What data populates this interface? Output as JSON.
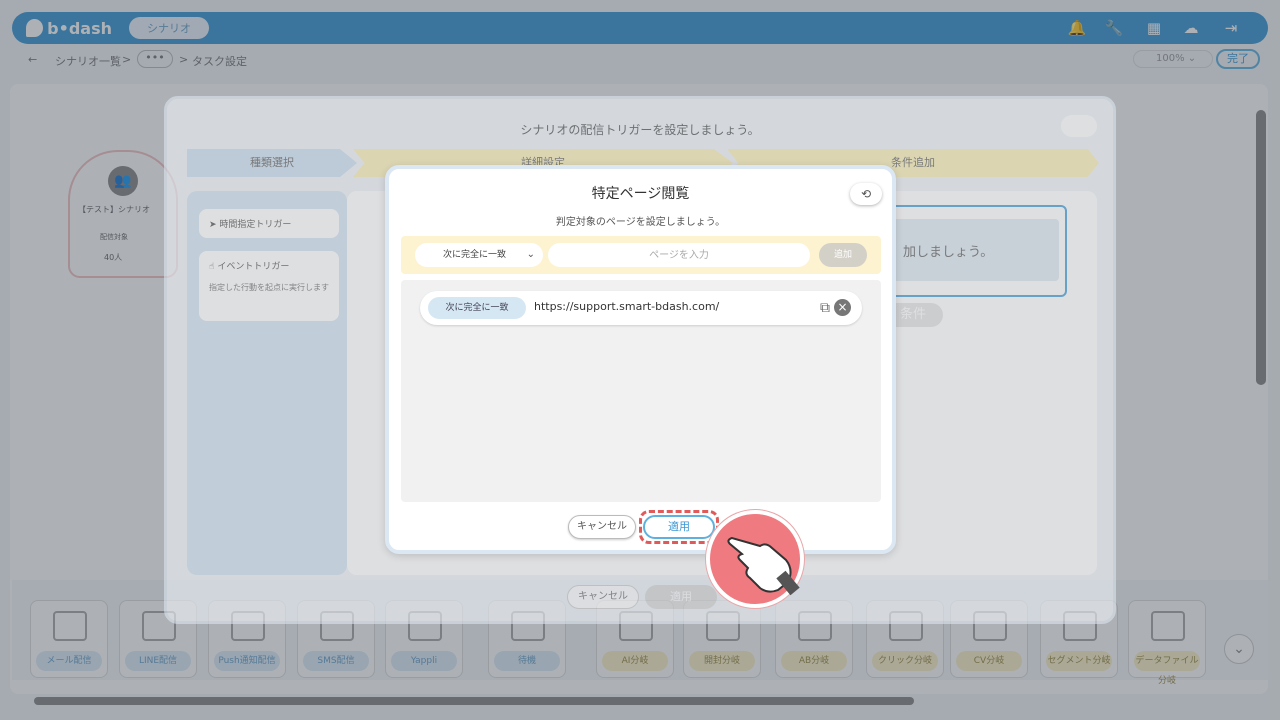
{
  "app": {
    "logo_text": "b•dash",
    "scenario_button": "シナリオ"
  },
  "header_icons": [
    "bell-icon",
    "wrench-icon",
    "grid-icon",
    "chat-icon",
    "logout-icon"
  ],
  "breadcrumb": {
    "back": "←",
    "list": "シナリオ一覧",
    "sep1": ">",
    "more": "•••",
    "sep2": ">",
    "current": "タスク設定"
  },
  "toolbar": {
    "zoom": "100%",
    "done": "完了"
  },
  "node": {
    "title": "【テスト】シナリオ",
    "sub": "配信対象",
    "count": "40人"
  },
  "palette": {
    "items": [
      {
        "label": "メール配信",
        "style": "blue"
      },
      {
        "label": "LINE配信",
        "style": "blue"
      },
      {
        "label": "Push通知配信",
        "style": "blue"
      },
      {
        "label": "SMS配信",
        "style": "blue"
      },
      {
        "label": "Yappli",
        "style": "blue"
      },
      {
        "label": "待機",
        "style": "blue"
      },
      {
        "label": "AI分岐",
        "style": "yel"
      },
      {
        "label": "開封分岐",
        "style": "yel"
      },
      {
        "label": "AB分岐",
        "style": "yel"
      },
      {
        "label": "クリック分岐",
        "style": "yel"
      },
      {
        "label": "CV分岐",
        "style": "yel"
      },
      {
        "label": "セグメント分岐",
        "style": "yel"
      },
      {
        "label": "データファイル分岐",
        "style": "yel"
      }
    ]
  },
  "trigger_modal": {
    "title": "シナリオの配信トリガーを設定しましょう。",
    "steps": [
      "種類選択",
      "詳細設定",
      "条件追加"
    ],
    "items": [
      {
        "label": "時間指定トリガー"
      },
      {
        "label": "イベントトリガー",
        "desc": "指定した行動を起点に実行します"
      }
    ],
    "box_text": "加しましょう。",
    "cond_button": "条件",
    "cancel": "キャンセル",
    "apply": "適用"
  },
  "page_modal": {
    "title": "特定ページ閲覧",
    "subtitle": "判定対象のページを設定しましょう。",
    "match_select": "次に完全に一致",
    "input_placeholder": "ページを入力",
    "add_button": "追加",
    "entries": [
      {
        "match": "次に完全に一致",
        "url": "https://support.smart-bdash.com/"
      }
    ],
    "cancel": "キャンセル",
    "apply": "適用"
  },
  "colors": {
    "accent": "#3b98d4",
    "highlight": "#e05a5a",
    "pointer": "#ef7a80"
  }
}
